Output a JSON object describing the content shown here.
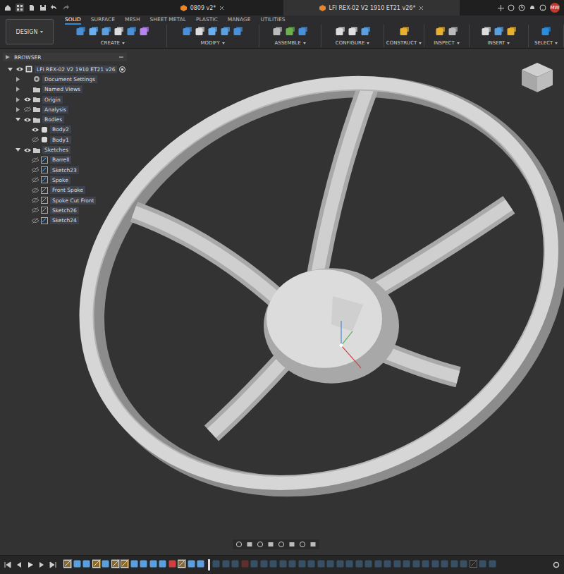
{
  "app_tabs": [
    {
      "label": "0809 v2*",
      "selected": false
    },
    {
      "label": "LFI REX-02 V2 1910 ET21 v26*",
      "selected": true
    }
  ],
  "user_initials": "MW",
  "workspace": "DESIGN",
  "ribbon_tabs": [
    {
      "label": "SOLID",
      "selected": true
    },
    {
      "label": "SURFACE",
      "selected": false
    },
    {
      "label": "MESH",
      "selected": false
    },
    {
      "label": "SHEET METAL",
      "selected": false
    },
    {
      "label": "PLASTIC",
      "selected": false
    },
    {
      "label": "MANAGE",
      "selected": false
    },
    {
      "label": "UTILITIES",
      "selected": false
    }
  ],
  "ribbon_groups": [
    "CREATE",
    "MODIFY",
    "ASSEMBLE",
    "CONFIGURE",
    "CONSTRUCT",
    "INSPECT",
    "INSERT",
    "SELECT"
  ],
  "browser": {
    "title": "BROWSER",
    "items": [
      {
        "label": "LFI REX-02 V2 1910 ET21 v26",
        "depth": 0,
        "kind": "component",
        "expanded": true,
        "eye": "shown"
      },
      {
        "label": "Document Settings",
        "depth": 1,
        "kind": "settings",
        "expanded": false,
        "eye": "none"
      },
      {
        "label": "Named Views",
        "depth": 1,
        "kind": "folder",
        "expanded": false,
        "eye": "none"
      },
      {
        "label": "Origin",
        "depth": 1,
        "kind": "folder",
        "expanded": false,
        "eye": "shown"
      },
      {
        "label": "Analysis",
        "depth": 1,
        "kind": "folder",
        "expanded": false,
        "eye": "hidden"
      },
      {
        "label": "Bodies",
        "depth": 1,
        "kind": "folder",
        "expanded": true,
        "eye": "shown"
      },
      {
        "label": "Body2",
        "depth": 2,
        "kind": "body",
        "expanded": false,
        "eye": "shown"
      },
      {
        "label": "Body1",
        "depth": 2,
        "kind": "body",
        "expanded": false,
        "eye": "hidden"
      },
      {
        "label": "Sketches",
        "depth": 1,
        "kind": "folder",
        "expanded": true,
        "eye": "shown"
      },
      {
        "label": "Barrell",
        "depth": 2,
        "kind": "sketch",
        "expanded": false,
        "eye": "hidden"
      },
      {
        "label": "Sketch23",
        "depth": 2,
        "kind": "sketch",
        "expanded": false,
        "eye": "hidden"
      },
      {
        "label": "Spoke",
        "depth": 2,
        "kind": "sketch",
        "expanded": false,
        "eye": "hidden"
      },
      {
        "label": "Front Spoke",
        "depth": 2,
        "kind": "sketch",
        "expanded": false,
        "eye": "hidden"
      },
      {
        "label": "Spoke Cut Front",
        "depth": 2,
        "kind": "sketch",
        "expanded": false,
        "eye": "hidden"
      },
      {
        "label": "Sketch26",
        "depth": 2,
        "kind": "sketch",
        "expanded": false,
        "eye": "hidden"
      },
      {
        "label": "Sketch24",
        "depth": 2,
        "kind": "sketch",
        "expanded": false,
        "eye": "hidden"
      }
    ]
  },
  "timeline": {
    "items": [
      {
        "kind": "sketch",
        "rolled_back": false
      },
      {
        "kind": "feature",
        "rolled_back": false
      },
      {
        "kind": "feature",
        "rolled_back": false
      },
      {
        "kind": "sketch",
        "rolled_back": false
      },
      {
        "kind": "feature",
        "rolled_back": false
      },
      {
        "kind": "sketch",
        "rolled_back": false
      },
      {
        "kind": "sketch",
        "rolled_back": false
      },
      {
        "kind": "feature",
        "rolled_back": false
      },
      {
        "kind": "feature",
        "rolled_back": false
      },
      {
        "kind": "feature",
        "rolled_back": false
      },
      {
        "kind": "feature",
        "rolled_back": false
      },
      {
        "kind": "error",
        "rolled_back": false
      },
      {
        "kind": "sketch",
        "rolled_back": false
      },
      {
        "kind": "feature",
        "rolled_back": false
      },
      {
        "kind": "feature",
        "rolled_back": false
      },
      {
        "kind": "feature",
        "rolled_back": true
      },
      {
        "kind": "feature",
        "rolled_back": true
      },
      {
        "kind": "feature",
        "rolled_back": true
      },
      {
        "kind": "error",
        "rolled_back": true
      },
      {
        "kind": "feature",
        "rolled_back": true
      },
      {
        "kind": "feature",
        "rolled_back": true
      },
      {
        "kind": "feature",
        "rolled_back": true
      },
      {
        "kind": "feature",
        "rolled_back": true
      },
      {
        "kind": "feature",
        "rolled_back": true
      },
      {
        "kind": "feature",
        "rolled_back": true
      },
      {
        "kind": "feature",
        "rolled_back": true
      },
      {
        "kind": "feature",
        "rolled_back": true
      },
      {
        "kind": "feature",
        "rolled_back": true
      },
      {
        "kind": "feature",
        "rolled_back": true
      },
      {
        "kind": "feature",
        "rolled_back": true
      },
      {
        "kind": "feature",
        "rolled_back": true
      },
      {
        "kind": "feature",
        "rolled_back": true
      },
      {
        "kind": "feature",
        "rolled_back": true
      },
      {
        "kind": "feature",
        "rolled_back": true
      },
      {
        "kind": "feature",
        "rolled_back": true
      },
      {
        "kind": "feature",
        "rolled_back": true
      },
      {
        "kind": "feature",
        "rolled_back": true
      },
      {
        "kind": "feature",
        "rolled_back": true
      },
      {
        "kind": "feature",
        "rolled_back": true
      },
      {
        "kind": "feature",
        "rolled_back": true
      },
      {
        "kind": "feature",
        "rolled_back": true
      },
      {
        "kind": "feature",
        "rolled_back": true
      },
      {
        "kind": "sketch",
        "rolled_back": true
      },
      {
        "kind": "feature",
        "rolled_back": true
      },
      {
        "kind": "feature",
        "rolled_back": true
      }
    ]
  }
}
